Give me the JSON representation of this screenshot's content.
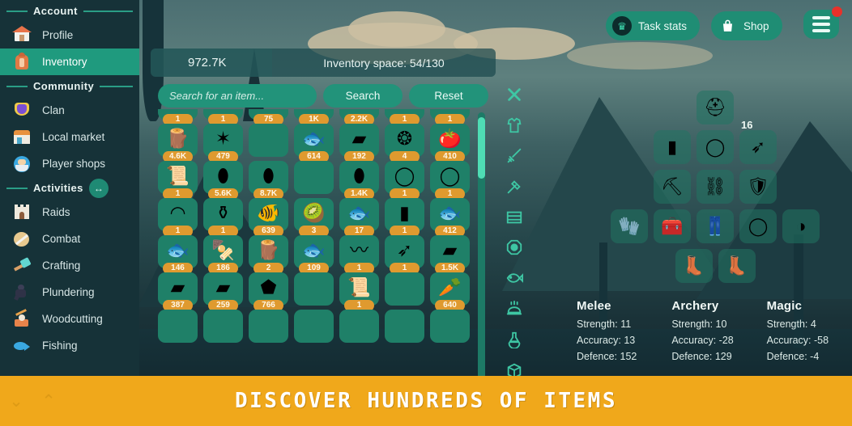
{
  "sidebar": {
    "sections": [
      {
        "title": "Account",
        "items": [
          {
            "label": "Profile",
            "icon": "house-icon",
            "active": false
          },
          {
            "label": "Inventory",
            "icon": "backpack-icon",
            "active": true
          }
        ]
      },
      {
        "title": "Community",
        "items": [
          {
            "label": "Clan",
            "icon": "shield-icon",
            "active": false
          },
          {
            "label": "Local market",
            "icon": "market-stall-icon",
            "active": false
          },
          {
            "label": "Player shops",
            "icon": "merchant-icon",
            "active": false
          }
        ]
      },
      {
        "title": "Activities",
        "swap_icon": "left-right-arrow-icon",
        "items": [
          {
            "label": "Raids",
            "icon": "castle-icon",
            "active": false
          },
          {
            "label": "Combat",
            "icon": "sword-shield-icon",
            "active": false
          },
          {
            "label": "Crafting",
            "icon": "crafting-tool-icon",
            "active": false
          },
          {
            "label": "Plundering",
            "icon": "thief-icon",
            "active": false
          },
          {
            "label": "Woodcutting",
            "icon": "axe-stump-icon",
            "active": false
          },
          {
            "label": "Fishing",
            "icon": "fish-icon",
            "active": false
          }
        ]
      }
    ]
  },
  "topbar": {
    "task_stats_label": "Task stats",
    "task_stats_icon": "crown-icon",
    "shop_label": "Shop",
    "shop_icon": "shopping-bag-icon",
    "menu_icon": "hamburger-menu-icon",
    "menu_has_notification": true
  },
  "statbar": {
    "gold": "972.7K",
    "gold_icon": "gold-coins-icon",
    "inventory_space": "Inventory space: 54/130"
  },
  "search": {
    "placeholder": "Search for an item...",
    "value": "",
    "search_label": "Search",
    "reset_label": "Reset"
  },
  "filters": [
    {
      "name": "close-icon"
    },
    {
      "name": "shirt-armor-icon"
    },
    {
      "name": "sword-icon"
    },
    {
      "name": "hammer-icon"
    },
    {
      "name": "plank-icon"
    },
    {
      "name": "gem-icon"
    },
    {
      "name": "fish-icon"
    },
    {
      "name": "cooked-food-icon"
    },
    {
      "name": "potion-flask-icon"
    },
    {
      "name": "crate-box-icon"
    }
  ],
  "inventory": {
    "scroll_position": "near-top",
    "rows": [
      {
        "partial": true,
        "slots": [
          {
            "count": "1",
            "icon": "item-icon",
            "glyph": ""
          },
          {
            "count": "1",
            "icon": "item-icon",
            "glyph": ""
          },
          {
            "count": "75",
            "icon": "item-icon",
            "glyph": ""
          },
          {
            "count": "1K",
            "icon": "item-icon",
            "glyph": ""
          },
          {
            "count": "2.2K",
            "icon": "item-icon",
            "glyph": ""
          },
          {
            "count": "1",
            "icon": "item-icon",
            "glyph": ""
          },
          {
            "count": "1",
            "icon": "item-icon",
            "glyph": ""
          }
        ]
      },
      {
        "partial": false,
        "slots": [
          {
            "count": "4.6K",
            "icon": "log-icon",
            "glyph": "🪵"
          },
          {
            "count": "479",
            "icon": "seeds-icon",
            "glyph": "✶"
          },
          {
            "count": "",
            "icon": "empty-slot",
            "glyph": ""
          },
          {
            "count": "614",
            "icon": "raw-fish-icon",
            "glyph": "🐟"
          },
          {
            "count": "192",
            "icon": "gold-bar-icon",
            "glyph": "▰"
          },
          {
            "count": "4",
            "icon": "rune-icon",
            "glyph": "❂"
          },
          {
            "count": "410",
            "icon": "tomato-icon",
            "glyph": "🍅"
          }
        ]
      },
      {
        "partial": false,
        "slots": [
          {
            "count": "1",
            "icon": "scroll-axe-icon",
            "glyph": "📜"
          },
          {
            "count": "5.6K",
            "icon": "copper-ore-icon",
            "glyph": "⬮"
          },
          {
            "count": "8.7K",
            "icon": "coal-icon",
            "glyph": "⬮"
          },
          {
            "count": "",
            "icon": "empty-slot",
            "glyph": ""
          },
          {
            "count": "1.4K",
            "icon": "silver-ore-icon",
            "glyph": "⬮"
          },
          {
            "count": "1",
            "icon": "amulet-icon",
            "glyph": "◯"
          },
          {
            "count": "1",
            "icon": "ring-icon",
            "glyph": "◯"
          }
        ]
      },
      {
        "partial": false,
        "slots": [
          {
            "count": "1",
            "icon": "gold-ring-icon",
            "glyph": "◠"
          },
          {
            "count": "1",
            "icon": "potion-pair-icon",
            "glyph": "⚱"
          },
          {
            "count": "639",
            "icon": "perch-fish-icon",
            "glyph": "🐠"
          },
          {
            "count": "3",
            "icon": "kiwi-icon",
            "glyph": "🥝"
          },
          {
            "count": "17",
            "icon": "skewered-fish-icon",
            "glyph": "🐟"
          },
          {
            "count": "1",
            "icon": "red-cape-icon",
            "glyph": "▮"
          },
          {
            "count": "412",
            "icon": "silver-fish-icon",
            "glyph": "🐟"
          }
        ]
      },
      {
        "partial": false,
        "slots": [
          {
            "count": "146",
            "icon": "cooked-fish-icon",
            "glyph": "🐟"
          },
          {
            "count": "186",
            "icon": "skewer-icon",
            "glyph": "🍢"
          },
          {
            "count": "2",
            "icon": "log-roll-icon",
            "glyph": "🪵"
          },
          {
            "count": "109",
            "icon": "roasted-fish-icon",
            "glyph": "🐟"
          },
          {
            "count": "1",
            "icon": "string-icon",
            "glyph": "〰"
          },
          {
            "count": "1",
            "icon": "arrow-icon",
            "glyph": "➶"
          },
          {
            "count": "1.5K",
            "icon": "leather-icon",
            "glyph": "▰"
          }
        ]
      },
      {
        "partial": false,
        "slots": [
          {
            "count": "387",
            "icon": "copper-bar-icon",
            "glyph": "▰"
          },
          {
            "count": "259",
            "icon": "iron-bar-icon",
            "glyph": "▰"
          },
          {
            "count": "766",
            "icon": "stone-icon",
            "glyph": "⬟"
          },
          {
            "count": "",
            "icon": "empty-slot",
            "glyph": ""
          },
          {
            "count": "1",
            "icon": "scroll-pickaxe-icon",
            "glyph": "📜"
          },
          {
            "count": "",
            "icon": "empty-slot",
            "glyph": ""
          },
          {
            "count": "640",
            "icon": "carrot-icon",
            "glyph": "🥕"
          }
        ]
      },
      {
        "partial": true,
        "slots": [
          {
            "count": "",
            "icon": "empty-slot",
            "glyph": ""
          },
          {
            "count": "",
            "icon": "item-icon",
            "glyph": ""
          },
          {
            "count": "",
            "icon": "empty-slot",
            "glyph": ""
          },
          {
            "count": "",
            "icon": "empty-slot",
            "glyph": ""
          },
          {
            "count": "",
            "icon": "empty-slot",
            "glyph": ""
          },
          {
            "count": "",
            "icon": "empty-slot",
            "glyph": ""
          },
          {
            "count": "",
            "icon": "empty-slot",
            "glyph": ""
          }
        ]
      }
    ]
  },
  "equipment": {
    "rows": [
      [
        {
          "name": "helmet-slot",
          "filled": true,
          "glyph": "⛑",
          "count": ""
        }
      ],
      [
        {
          "name": "cape-slot",
          "filled": true,
          "glyph": "▮",
          "count": ""
        },
        {
          "name": "necklace-slot",
          "filled": true,
          "glyph": "◯",
          "count": ""
        },
        {
          "name": "ammo-slot",
          "filled": true,
          "glyph": "➶",
          "count": "16"
        }
      ],
      [
        {
          "name": "weapon-slot",
          "filled": true,
          "glyph": "⛏",
          "count": ""
        },
        {
          "name": "body-slot",
          "filled": true,
          "glyph": "⛓",
          "count": ""
        },
        {
          "name": "shield-slot",
          "filled": true,
          "glyph": "🛡",
          "count": ""
        }
      ],
      [
        {
          "name": "gloves-slot",
          "filled": true,
          "glyph": "🧤",
          "count": ""
        },
        {
          "name": "tool-belt-slot",
          "filled": true,
          "glyph": "🧰",
          "count": ""
        },
        {
          "name": "legs-slot",
          "filled": true,
          "glyph": "👖",
          "count": ""
        },
        {
          "name": "ring-slot",
          "filled": true,
          "glyph": "◯",
          "count": ""
        },
        {
          "name": "bracelet-slot",
          "filled": true,
          "glyph": "◑",
          "count": ""
        }
      ],
      [
        {
          "name": "boots-slot",
          "filled": true,
          "glyph": "👢",
          "count": ""
        },
        {
          "name": "secondary-boots-slot",
          "filled": true,
          "glyph": "👢",
          "count": ""
        }
      ]
    ]
  },
  "stats": {
    "columns": [
      {
        "title": "Melee",
        "lines": [
          "Strength: 11",
          "Accuracy: 13",
          "Defence: 152"
        ]
      },
      {
        "title": "Archery",
        "lines": [
          "Strength: 10",
          "Accuracy: -28",
          "Defence: 129"
        ]
      },
      {
        "title": "Magic",
        "lines": [
          "Strength: 4",
          "Accuracy: -58",
          "Defence: -4"
        ]
      }
    ]
  },
  "banner": {
    "text": "DISCOVER HUNDREDS OF ITEMS",
    "chevron_down_icon": "chevron-down-icon",
    "chevron_up_icon": "chevron-up-icon"
  },
  "colors": {
    "accent_teal": "#1f8d74",
    "slot_teal": "#1f8068",
    "badge_orange": "#df9a2f",
    "banner_orange": "#f0a81b",
    "sidebar_bg": "#163238",
    "active_item": "#1f9a7e",
    "notification_red": "#e8312a"
  }
}
